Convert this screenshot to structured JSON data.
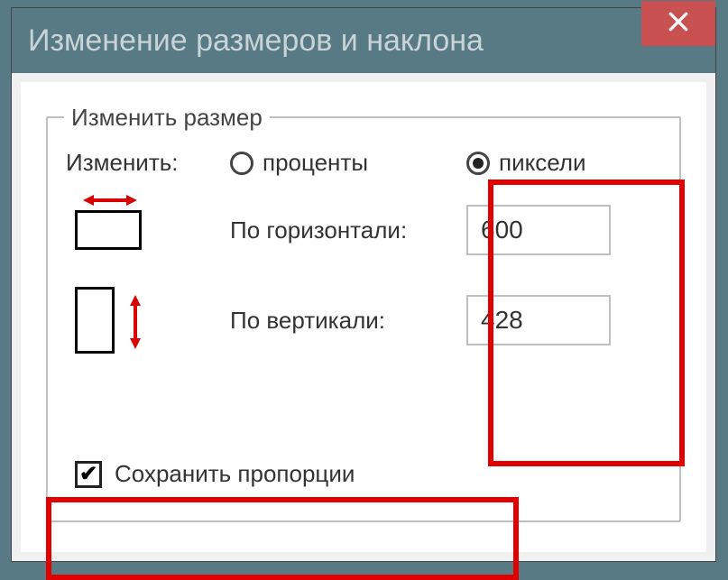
{
  "titlebar": {
    "title": "Изменение размеров и наклона"
  },
  "group": {
    "legend": "Изменить размер",
    "change_label": "Изменить:",
    "radio_percent": "проценты",
    "radio_pixels": "пиксели",
    "selected_radio": "pixels",
    "horizontal_label": "По горизонтали:",
    "vertical_label": "По вертикали:",
    "horizontal_value": "600",
    "vertical_value": "428",
    "keep_aspect_label": "Сохранить пропорции",
    "keep_aspect_checked": true
  }
}
